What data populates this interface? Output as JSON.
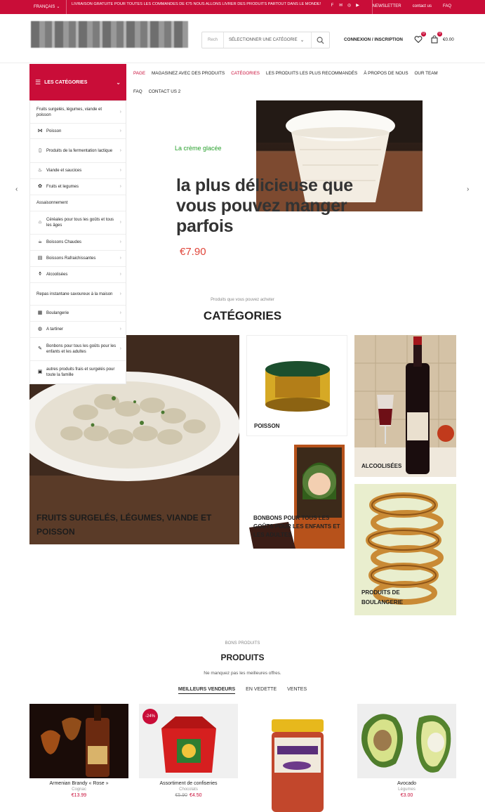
{
  "topbar": {
    "language": "FRANÇAIS",
    "promo": "LIVRAISON GRATUITE POUR TOUTES LES COMMANDES DE €75 NOUS ALLONS LIVRER DES PRODUITS PARTOUT DANS LE MONDE!",
    "links": [
      "NEWSLETTER",
      "contact us",
      "FAQ"
    ],
    "social_icons": [
      "facebook-icon",
      "mail-icon",
      "instagram-icon",
      "youtube-icon"
    ]
  },
  "header": {
    "search_placeholder": "Rech",
    "search_category": "SÉLECTIONNER UNE CATÉGORIE",
    "login": "CONNEXION / INSCRIPTION",
    "wishlist_count": "0",
    "cart_count": "0",
    "cart_total": "€0.00"
  },
  "categories_button": "LES CATÉGORIES",
  "sidebar": [
    {
      "label": "Fruits surgelés, légumes, viande et poisson",
      "icon": ""
    },
    {
      "label": "Poisson",
      "icon": "fish-icon"
    },
    {
      "label": "Produits de la fermentation lactique",
      "icon": "milk-icon"
    },
    {
      "label": "Viande et saucices",
      "icon": "meat-icon"
    },
    {
      "label": "Fruits et legumes",
      "icon": "fruit-icon"
    },
    {
      "label": "Assaisonnement",
      "icon": ""
    },
    {
      "label": "Céréales pour tous les goûts et tous les âges",
      "icon": "cereal-icon"
    },
    {
      "label": "Boissons Chaudes",
      "icon": "cup-icon"
    },
    {
      "label": "Boissons Rafraichissantes",
      "icon": "drink-icon"
    },
    {
      "label": "Alcoolisées",
      "icon": "bottle-icon"
    },
    {
      "label": "Repas instantane savoureux à la maison",
      "icon": ""
    },
    {
      "label": "Boulangerie",
      "icon": "bread-icon"
    },
    {
      "label": "A tartiner",
      "icon": "jar-icon"
    },
    {
      "label": "Bonbons pour tous les goûts pour les enfants et les adultes",
      "icon": "candy-icon"
    },
    {
      "label": "autres produits frais et surgelés pour toute la famille",
      "icon": "box-icon"
    }
  ],
  "menu": {
    "row1": [
      "PAGE",
      "MAGASINEZ AVEC DES PRODUITS",
      "CATÉGORIES",
      "LES PRODUITS LES PLUS RECOMMANDÉS",
      "À PROPOS DE NOUS",
      "OUR TEAM"
    ],
    "row2": [
      "FAQ",
      "CONTACT US 2"
    ]
  },
  "hero": {
    "subtitle": "La crème glacée",
    "title": "la plus délicieuse que vous pouvez manger parfois",
    "price": "€7.90"
  },
  "categories_section": {
    "kicker": "Produits que vous pouvez acheter",
    "title": "CATÉGORIES",
    "tiles": [
      {
        "label": "FRUITS SURGELÉS, LÉGUMES, VIANDE ET POISSON"
      },
      {
        "label": "POISSON"
      },
      {
        "label": "ALCOOLISÉES"
      },
      {
        "label": "BONBONS POUR TOUS LES GOÛTS POUR LES ENFANTS ET LES ADULTES"
      },
      {
        "label": "PRODUITS DE BOULANGERIE"
      }
    ]
  },
  "products_section": {
    "kicker": "BONS PRODUITS",
    "title": "PRODUITS",
    "subtitle": "Ne manquez pas les meilleures offres.",
    "tabs": [
      "MEILLEURS VENDEURS",
      "EN VEDETTE",
      "VENTES"
    ],
    "items": [
      {
        "name": "Armenian Brandy « Rose »",
        "category": "Cognac",
        "price": "€13.99",
        "old_price": "",
        "discount": ""
      },
      {
        "name": "Assortiment de confiseries",
        "category": "Chocolats",
        "price": "€4.50",
        "old_price": "€5.90",
        "discount": "-24%"
      },
      {
        "name": "",
        "category": "",
        "price": "",
        "old_price": "",
        "discount": ""
      },
      {
        "name": "Avocado",
        "category": "Légumes",
        "price": "€3.00",
        "old_price": "",
        "discount": ""
      }
    ]
  },
  "colors": {
    "accent": "#c90d38",
    "hero_sub": "#2aa12f",
    "hero_price": "#e0453a"
  }
}
